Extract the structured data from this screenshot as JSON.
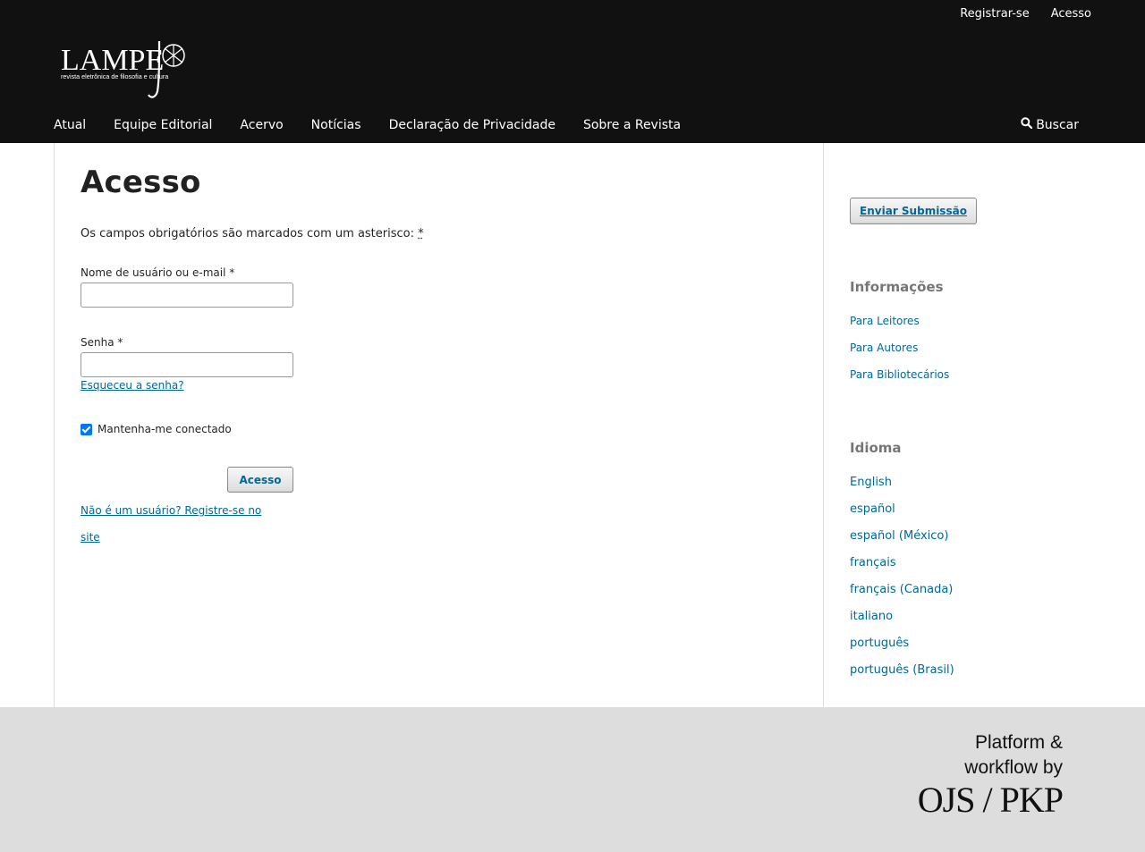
{
  "header": {
    "user_nav": {
      "register": "Registrar-se",
      "login": "Acesso"
    },
    "logo": {
      "title": "LAMPEJO",
      "title_main": "LAMPE",
      "subtitle": "revista eletrônica de filosofia e cultura"
    },
    "nav": [
      "Atual",
      "Equipe Editorial",
      "Acervo",
      "Notícias",
      "Declaração de Privacidade",
      "Sobre a Revista"
    ],
    "search_label": "Buscar",
    "icon": "search-icon"
  },
  "main": {
    "title": "Acesso",
    "required_note": "Os campos obrigatórios são marcados com um asterisco:",
    "required_mark": "*",
    "username_label": "Nome de usuário ou e-mail *",
    "username_value": "",
    "password_label": "Senha *",
    "password_value": "",
    "forgot_link": "Esqueceu a senha?",
    "remember_label": "Mantenha-me conectado",
    "remember_checked": true,
    "submit_label": "Acesso",
    "register_link": "Não é um usuário? Registre-se no site"
  },
  "sidebar": {
    "submit_button": "Enviar Submissão",
    "info_heading": "Informações",
    "info_links": [
      "Para Leitores",
      "Para Autores",
      "Para Bibliotecários"
    ],
    "language_heading": "Idioma",
    "languages": [
      "English",
      "español",
      "español (México)",
      "français",
      "français (Canada)",
      "italiano",
      "português",
      "português (Brasil)"
    ]
  },
  "footer": {
    "brand_line1": "Platform &",
    "brand_line2": "workflow by",
    "brand_logo": "OJS / PKP"
  },
  "colors": {
    "header_bg": "#111111",
    "link": "#006798",
    "footer_bg": "#dddddd"
  }
}
